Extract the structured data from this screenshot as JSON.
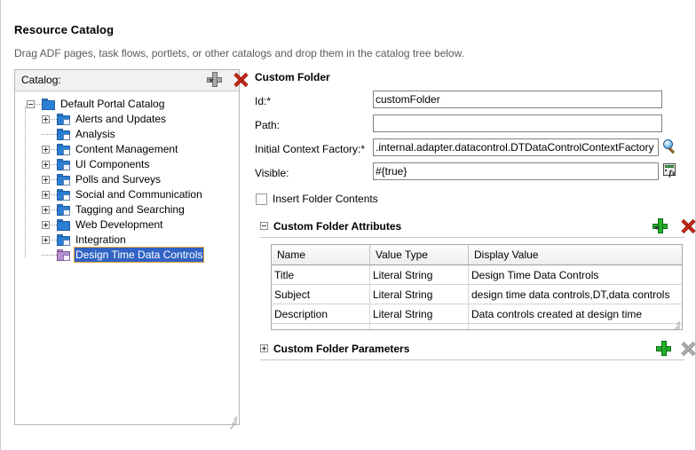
{
  "header": {
    "title": "Resource Catalog",
    "subtitle": "Drag ADF pages, task flows, portlets, or other catalogs and drop them in the catalog tree below."
  },
  "catalog_panel": {
    "toolbar_label": "Catalog:",
    "add_icon": "plus-icon",
    "add_dropdown_icon": "chevron-down-icon",
    "delete_icon": "red-x-icon",
    "resize_icon": "resize-grip-icon",
    "tree": [
      {
        "label": "Default Portal Catalog",
        "level": 0,
        "toggle": "minus",
        "icon": "folder-icon",
        "selected": false
      },
      {
        "label": "Alerts and Updates",
        "level": 1,
        "toggle": "plus",
        "icon": "folder-icon",
        "selected": false
      },
      {
        "label": "Analysis",
        "level": 1,
        "toggle": "none",
        "icon": "folder-icon",
        "selected": false
      },
      {
        "label": "Content Management",
        "level": 1,
        "toggle": "plus",
        "icon": "folder-icon",
        "selected": false
      },
      {
        "label": "UI Components",
        "level": 1,
        "toggle": "plus",
        "icon": "folder-icon",
        "selected": false
      },
      {
        "label": "Polls and Surveys",
        "level": 1,
        "toggle": "plus",
        "icon": "folder-icon",
        "selected": false
      },
      {
        "label": "Social and Communication",
        "level": 1,
        "toggle": "plus",
        "icon": "folder-icon",
        "selected": false
      },
      {
        "label": "Tagging and Searching",
        "level": 1,
        "toggle": "plus",
        "icon": "folder-icon",
        "selected": false
      },
      {
        "label": "Web Development",
        "level": 1,
        "toggle": "plus",
        "icon": "folder-icon",
        "selected": false
      },
      {
        "label": "Integration",
        "level": 1,
        "toggle": "plus",
        "icon": "folder-icon",
        "selected": false
      },
      {
        "label": "Design Time Data Controls",
        "level": 1,
        "toggle": "none",
        "icon": "folder-icon-purple",
        "selected": true
      }
    ]
  },
  "detail": {
    "title": "Custom Folder",
    "fields": [
      {
        "label": "Id:*",
        "value": "customFolder",
        "button": null
      },
      {
        "label": "Path:",
        "value": "",
        "button": null
      },
      {
        "label": "Initial Context Factory:*",
        "value": ".internal.adapter.datacontrol.DTDataControlContextFactory",
        "button": "search-icon"
      },
      {
        "label": "Visible:",
        "value": "#{true}",
        "button": "expression-builder-icon"
      }
    ],
    "checkbox": {
      "label": "Insert Folder Contents",
      "checked": false
    },
    "attributes_section": {
      "title": "Custom Folder Attributes",
      "expanded": true,
      "add_icon": "plus-icon",
      "add_dropdown_icon": "chevron-down-icon",
      "delete_icon": "red-x-icon",
      "columns": [
        "Name",
        "Value Type",
        "Display Value"
      ],
      "rows": [
        [
          "Title",
          "Literal String",
          "Design Time Data Controls"
        ],
        [
          "Subject",
          "Literal String",
          "design time data controls,DT,data controls"
        ],
        [
          "Description",
          "Literal String",
          "Data controls created at design time"
        ]
      ]
    },
    "parameters_section": {
      "title": "Custom Folder Parameters",
      "expanded": false,
      "add_icon": "plus-icon",
      "delete_icon": "grey-x-icon"
    }
  },
  "colors": {
    "selection_blue": "#3163c4",
    "focus_orange": "#e8a33d",
    "folder_blue": "#2a7fd4",
    "folder_purple": "#b58fd0",
    "add_green": "#22b02a",
    "delete_red": "#d42a19",
    "subtitle_grey": "#5a5a5a"
  }
}
